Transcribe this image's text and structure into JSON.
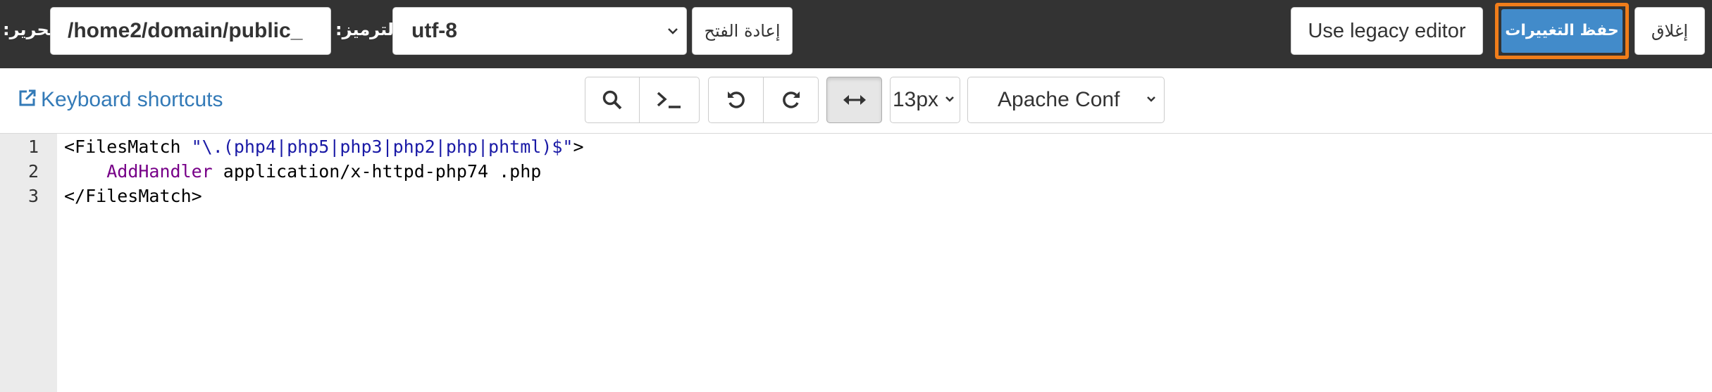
{
  "header": {
    "edit_label": "تحرير:",
    "path_value": "/home2/domain/public_",
    "encoding_label": "الترميز:",
    "encoding_value": "utf-8",
    "reopen_label": "إعادة الفتح",
    "legacy_label": "Use legacy editor",
    "save_label": "حفظ التغييرات",
    "close_label": "إغلاق"
  },
  "toolbar": {
    "shortcuts_label": "Keyboard shortcuts",
    "font_size": "13px",
    "mode": "Apache Conf"
  },
  "editor": {
    "line_numbers": [
      "1",
      "2",
      "3"
    ],
    "lines": [
      {
        "pre": "<FilesMatch ",
        "str": "\"\\.(php4|php5|php3|php2|php|phtml)$\"",
        "post": ">"
      },
      {
        "indent": "    ",
        "kw": "AddHandler",
        "rest": " application/x-httpd-php74 .php"
      },
      {
        "text": "</FilesMatch>"
      }
    ]
  },
  "colors": {
    "topbar_bg": "#333333",
    "save_bg": "#428bca",
    "save_highlight": "#f07d1a",
    "link": "#337ab7",
    "string": "#1a1aa6",
    "keyword": "#770088"
  },
  "icons": [
    "external-link-icon",
    "search-icon",
    "terminal-icon",
    "undo-icon",
    "redo-icon",
    "wrap-arrows-icon",
    "chevron-down-icon"
  ]
}
